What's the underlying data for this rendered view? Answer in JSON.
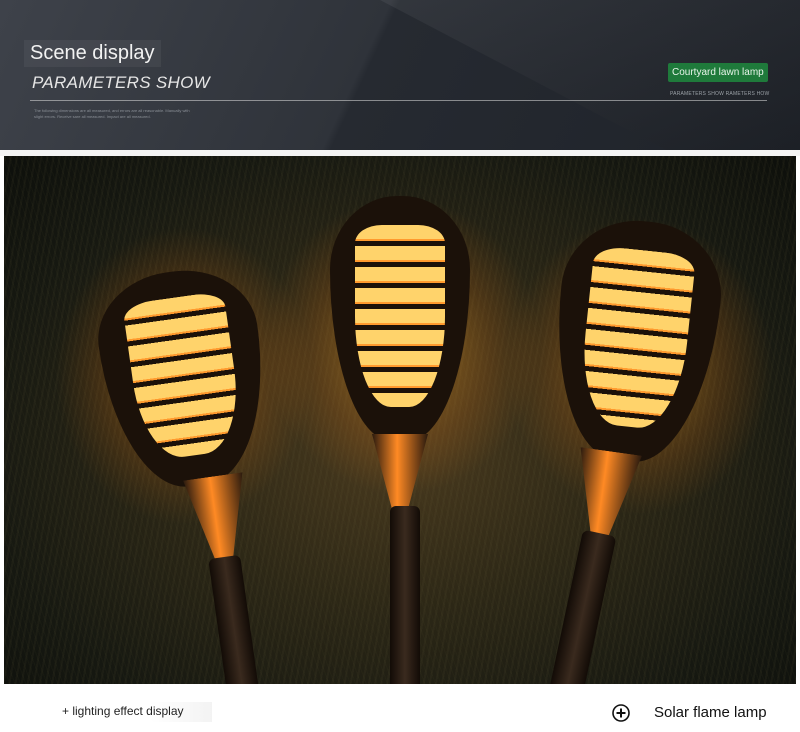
{
  "header": {
    "scene_title": "Scene display",
    "param_title": "PARAMETERS SHOW",
    "fine_text": "The following dimensions are all measured, and errors are all reasonable. Manually with slight errors. Receive sare all measured. Impact are all measured.",
    "tag_label": "Courtyard lawn lamp",
    "tag_sub": "PARAMETERS SHOW RAMETERS HOW"
  },
  "photo": {
    "subject": "solar-flame-torches",
    "icon": "torch-photo"
  },
  "footer": {
    "left_caption": "+ lighting effect display",
    "right_caption": "Solar flame lamp",
    "icon": "plus-circle-icon"
  },
  "colors": {
    "header_bg": "#2f333a",
    "tag_green": "#1f7a3b",
    "flame": "#ffb347"
  }
}
